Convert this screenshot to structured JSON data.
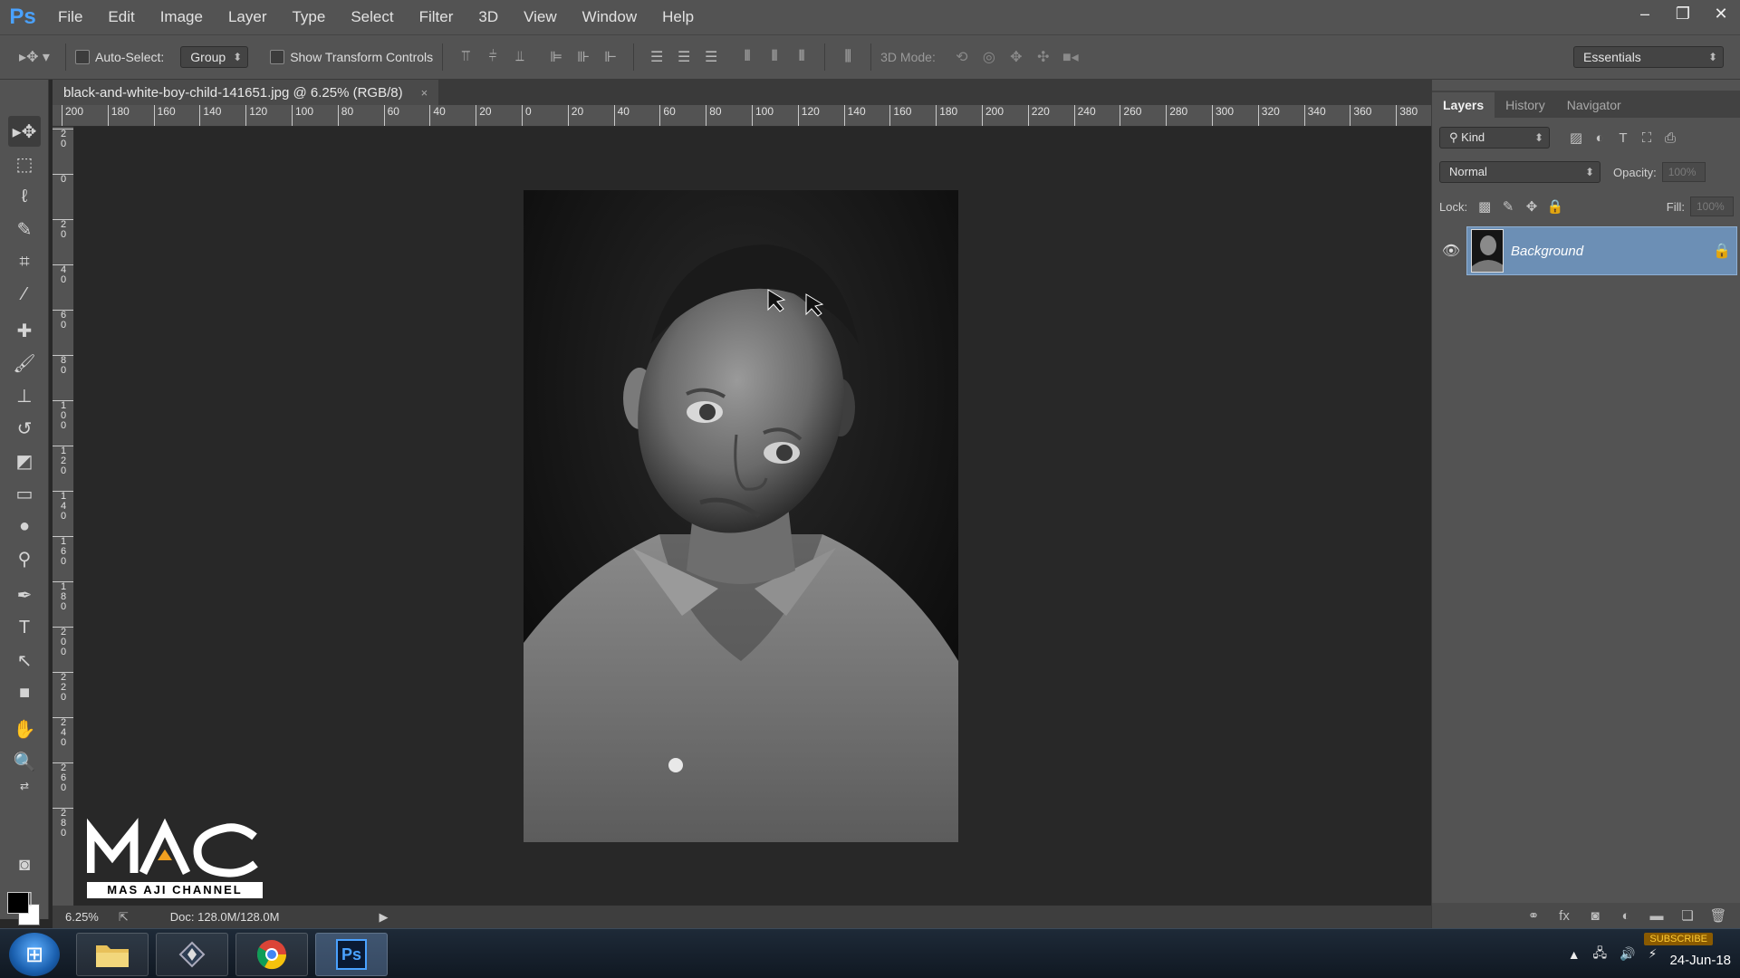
{
  "app": {
    "logo": "Ps"
  },
  "menu": [
    "File",
    "Edit",
    "Image",
    "Layer",
    "Type",
    "Select",
    "Filter",
    "3D",
    "View",
    "Window",
    "Help"
  ],
  "window_controls": {
    "minimize": "–",
    "restore": "❐",
    "close": "✕"
  },
  "options": {
    "auto_select_label": "Auto-Select:",
    "auto_select_value": "Group",
    "transform_label": "Show Transform Controls",
    "mode_label": "3D Mode:",
    "workspace": "Essentials"
  },
  "document": {
    "tab_title": "black-and-white-boy-child-141651.jpg @ 6.25% (RGB/8)",
    "close": "×"
  },
  "ruler": {
    "top": [
      "200",
      "180",
      "160",
      "140",
      "120",
      "100",
      "80",
      "60",
      "40",
      "20",
      "0",
      "20",
      "40",
      "60",
      "80",
      "100",
      "120",
      "140",
      "160",
      "180",
      "200",
      "220",
      "240",
      "260",
      "280",
      "300",
      "320",
      "340",
      "360",
      "380"
    ],
    "left": [
      "2\n0",
      "0",
      "2\n0",
      "4\n0",
      "6\n0",
      "8\n0",
      "1\n0\n0",
      "1\n2\n0",
      "1\n4\n0",
      "1\n6\n0",
      "1\n8\n0",
      "2\n0\n0",
      "2\n2\n0",
      "2\n4\n0",
      "2\n6\n0",
      "2\n8\n0"
    ]
  },
  "status": {
    "zoom": "6.25%",
    "doc": "Doc: 128.0M/128.0M"
  },
  "panel": {
    "tabs": [
      "Layers",
      "History",
      "Navigator"
    ],
    "filter": "Kind",
    "blend_mode": "Normal",
    "opacity_label": "Opacity:",
    "opacity_value": "100%",
    "lock_label": "Lock:",
    "fill_label": "Fill:",
    "fill_value": "100%",
    "layer_name": "Background"
  },
  "watermark": {
    "logo_text": "MAC",
    "subtitle": "MAS AJI CHANNEL"
  },
  "taskbar": {
    "date": "24-Jun-18",
    "subscribe": "SUBSCRIBE",
    "ps_app": "Ps"
  },
  "colors": {
    "accent": "#4aa2ff",
    "selected_layer": "#6c8fb5",
    "logo_accent": "#f0a020"
  }
}
